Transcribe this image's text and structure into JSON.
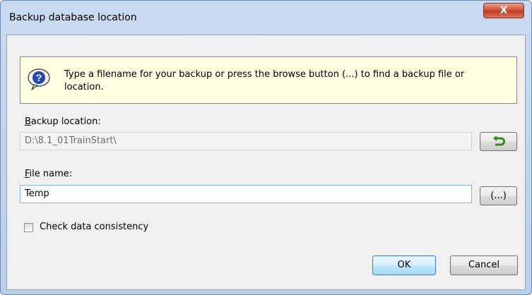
{
  "window": {
    "title": "Backup database location",
    "close_label": "X"
  },
  "info": {
    "icon": "help-question-icon",
    "text": "Type a filename for your backup or press the browse button  (...)  to find a backup file or location."
  },
  "backup_location": {
    "label_accel": "B",
    "label_rest": "ackup location:",
    "value": "D:\\8.1_01TrainStart\\",
    "reset_icon": "undo-arrow-icon"
  },
  "file_name": {
    "label_accel": "F",
    "label_rest": "ile name:",
    "value": "Temp",
    "browse_label": "(...)"
  },
  "check_consistency": {
    "label": "Check data consistency",
    "checked": false
  },
  "buttons": {
    "ok": "OK",
    "cancel": "Cancel"
  },
  "colors": {
    "info_bg": "#ffffe1",
    "close_red": "#c43a22",
    "reset_green": "#2e8b1f"
  }
}
